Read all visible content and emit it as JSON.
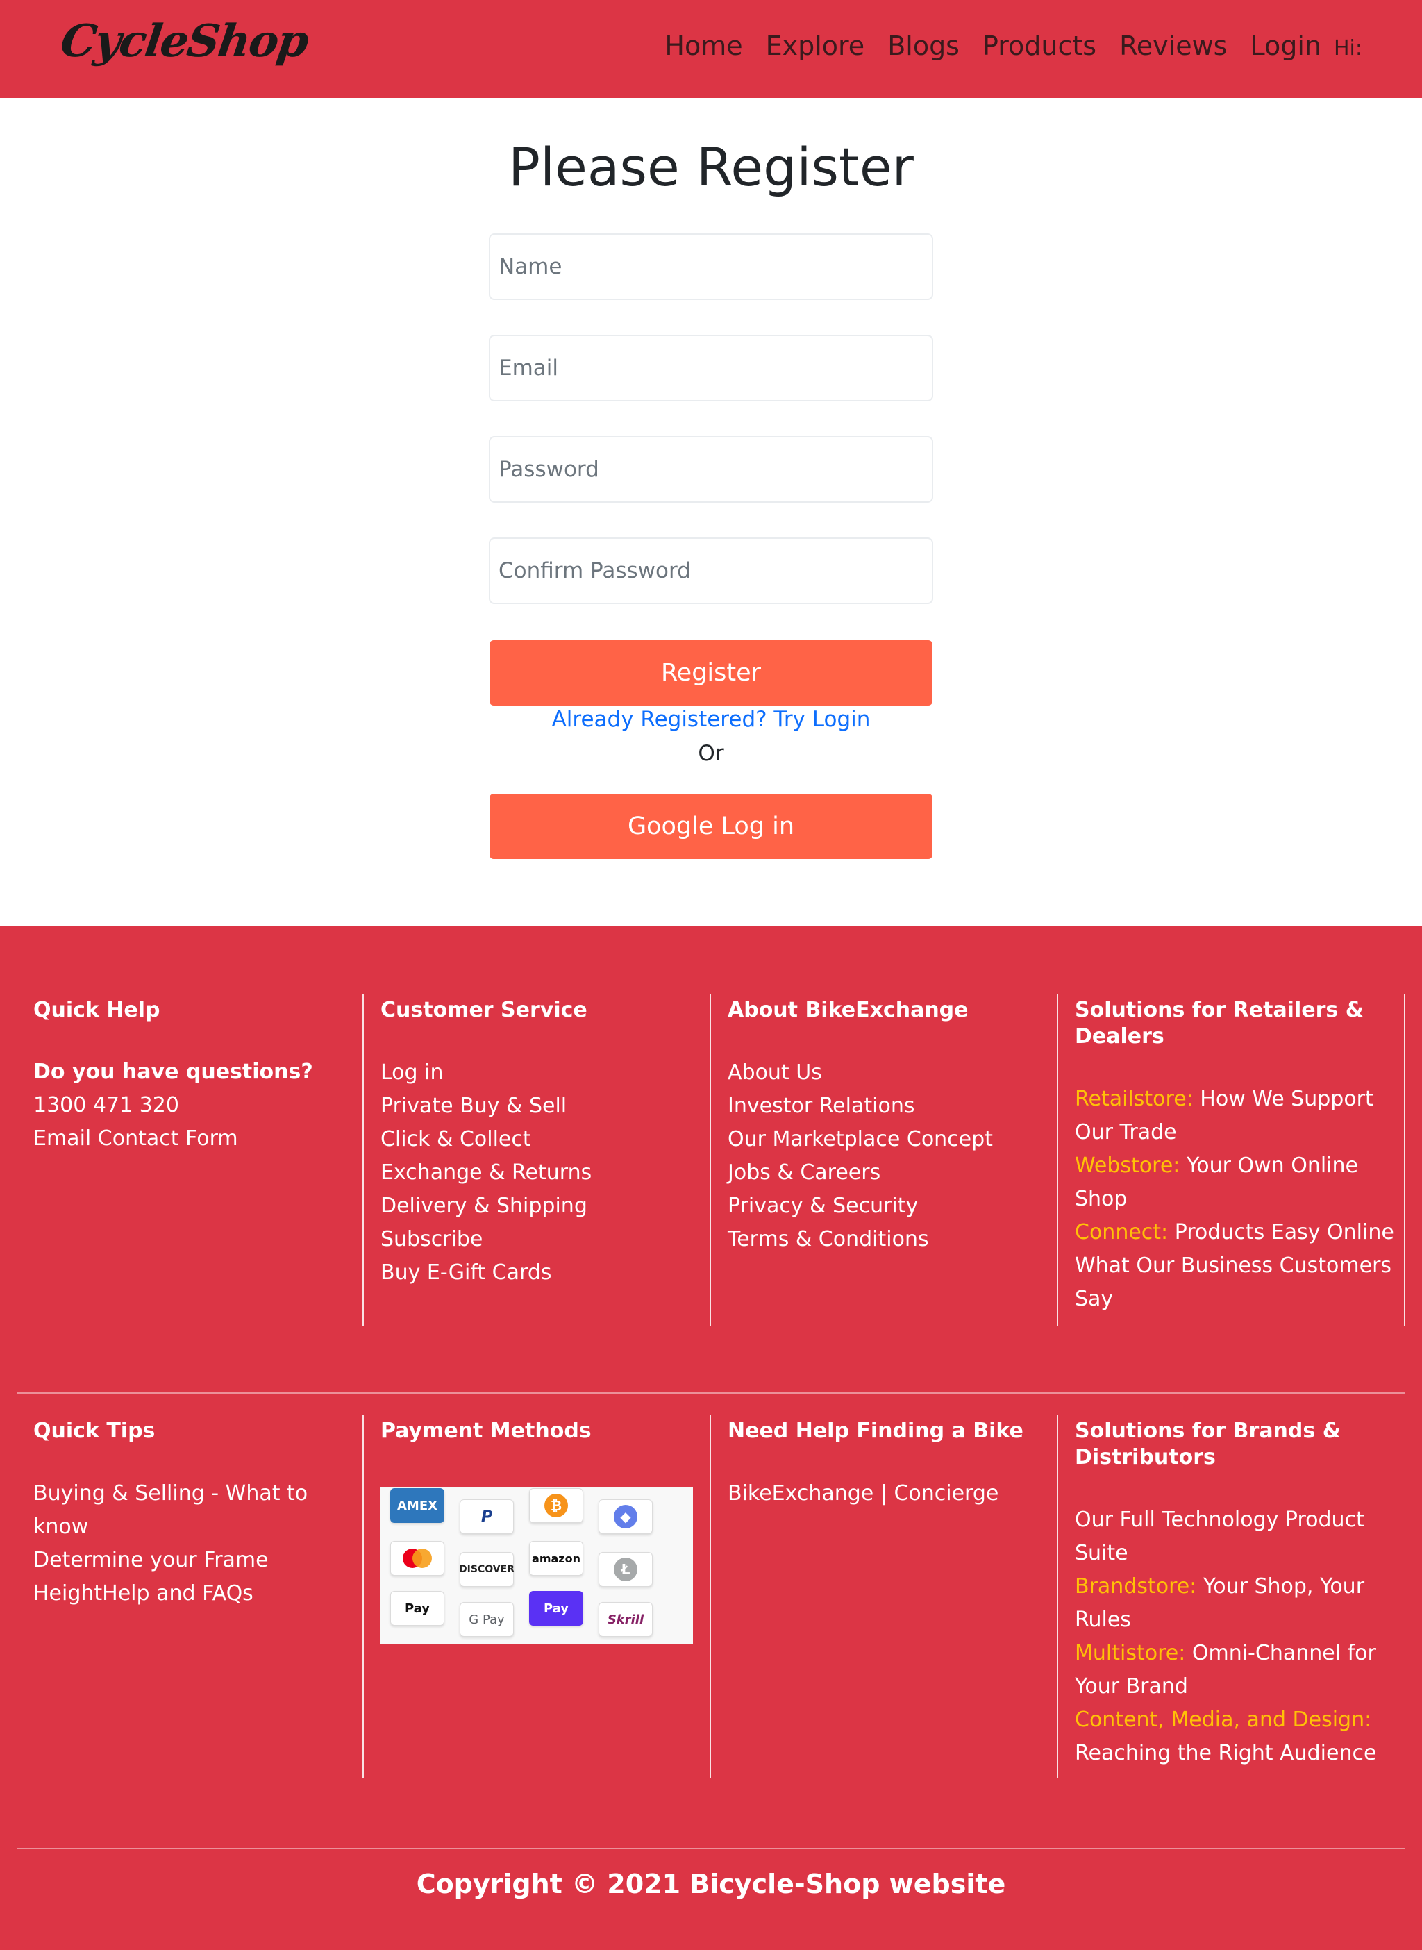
{
  "navbar": {
    "brand": "CycleShop",
    "links": [
      "Home",
      "Explore",
      "Blogs",
      "Products",
      "Reviews",
      "Login"
    ],
    "greeting": "Hi:"
  },
  "register": {
    "title": "Please Register",
    "name_placeholder": "Name",
    "email_placeholder": "Email",
    "password_placeholder": "Password",
    "confirm_placeholder": "Confirm Password",
    "register_button": "Register",
    "login_link": "Already Registered? Try Login",
    "or_text": "Or",
    "google_button": "Google Log in"
  },
  "footer": {
    "quick_help": {
      "heading": "Quick Help",
      "question": "Do you have questions?",
      "items": [
        "1300 471 320",
        "Email Contact Form"
      ]
    },
    "customer_service": {
      "heading": "Customer Service",
      "items": [
        "Log in",
        "Private Buy & Sell",
        "Click & Collect",
        "Exchange & Returns",
        "Delivery & Shipping",
        "Subscribe",
        "Buy E-Gift Cards"
      ]
    },
    "about": {
      "heading": "About BikeExchange",
      "items": [
        "About Us",
        "Investor Relations",
        "Our Marketplace Concept",
        "Jobs & Careers",
        "Privacy & Security",
        "Terms & Conditions"
      ]
    },
    "retailers": {
      "heading": "Solutions for Retailers & Dealers",
      "items": [
        {
          "highlight": "Retailstore:",
          "text": " How We Support Our Trade"
        },
        {
          "highlight": "Webstore:",
          "text": " Your Own Online Shop"
        },
        {
          "highlight": "Connect:",
          "text": " Products Easy Online"
        },
        {
          "highlight": "",
          "text": "What Our Business Customers Say"
        }
      ]
    },
    "quick_tips": {
      "heading": "Quick Tips",
      "items": [
        "Buying & Selling - What to know",
        "Determine your Frame HeightHelp and FAQs"
      ]
    },
    "payment": {
      "heading": "Payment Methods",
      "methods": [
        "AMEX",
        "PayPal",
        "Bitcoin",
        "Ethereum",
        "Mastercard",
        "DISCOVER",
        "amazon",
        "Litecoin",
        "Apple Pay",
        "G Pay",
        "Pay",
        "Skrill"
      ]
    },
    "finding": {
      "heading": "Need Help Finding a Bike",
      "items": [
        "BikeExchange | Concierge"
      ]
    },
    "brands": {
      "heading": "Solutions for Brands & Distributors",
      "items": [
        {
          "highlight": "",
          "text": "Our Full Technology Product Suite"
        },
        {
          "highlight": "Brandstore:",
          "text": " Your Shop, Your Rules"
        },
        {
          "highlight": "Multistore:",
          "text": " Omni-Channel for Your Brand"
        },
        {
          "highlight": "Content, Media, and Design:",
          "text": " Reaching the Right Audience"
        }
      ]
    },
    "copyright": "Copyright © 2021 Bicycle-Shop website"
  },
  "colors": {
    "primary_red": "#dc3545",
    "button_tomato": "#ff6347",
    "link_blue": "#0d6efd",
    "highlight_yellow": "#ffc107"
  }
}
